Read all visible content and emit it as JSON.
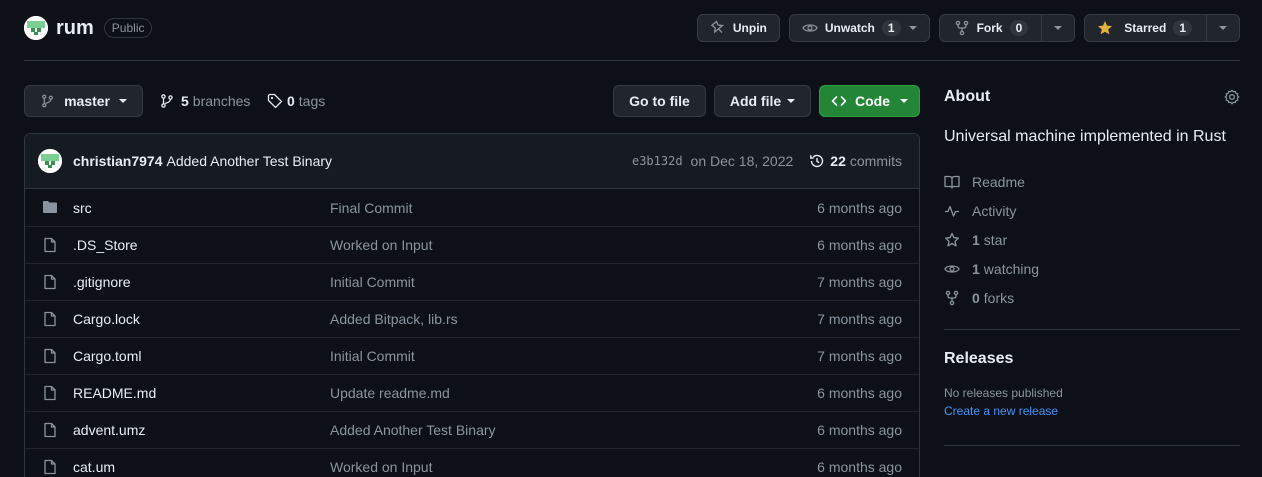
{
  "repo": {
    "name": "rum",
    "visibility": "Public",
    "actions": {
      "unpin": "Unpin",
      "unwatch": "Unwatch",
      "unwatch_count": "1",
      "fork": "Fork",
      "fork_count": "0",
      "starred": "Starred",
      "starred_count": "1"
    }
  },
  "toolbar": {
    "branch": "master",
    "branches_count": "5",
    "branches_label": "branches",
    "tags_count": "0",
    "tags_label": "tags",
    "go_to_file": "Go to file",
    "add_file": "Add file",
    "code": "Code"
  },
  "commit": {
    "author": "christian7974",
    "message": "Added Another Test Binary",
    "sha": "e3b132d",
    "date": "on Dec 18, 2022",
    "commits_count": "22",
    "commits_label": "commits"
  },
  "files": [
    {
      "name": "src",
      "message": "Final Commit",
      "age": "6 months ago",
      "type": "folder"
    },
    {
      "name": ".DS_Store",
      "message": "Worked on Input",
      "age": "6 months ago",
      "type": "file"
    },
    {
      "name": ".gitignore",
      "message": "Initial Commit",
      "age": "7 months ago",
      "type": "file"
    },
    {
      "name": "Cargo.lock",
      "message": "Added Bitpack, lib.rs",
      "age": "7 months ago",
      "type": "file"
    },
    {
      "name": "Cargo.toml",
      "message": "Initial Commit",
      "age": "7 months ago",
      "type": "file"
    },
    {
      "name": "README.md",
      "message": "Update readme.md",
      "age": "6 months ago",
      "type": "file"
    },
    {
      "name": "advent.umz",
      "message": "Added Another Test Binary",
      "age": "6 months ago",
      "type": "file"
    },
    {
      "name": "cat.um",
      "message": "Worked on Input",
      "age": "6 months ago",
      "type": "file"
    }
  ],
  "about": {
    "title": "About",
    "description": "Universal machine implemented in Rust",
    "readme": "Readme",
    "activity": "Activity",
    "stars_count": "1",
    "stars_label": "star",
    "watching_count": "1",
    "watching_label": "watching",
    "forks_count": "0",
    "forks_label": "forks"
  },
  "releases": {
    "title": "Releases",
    "none": "No releases published",
    "create": "Create a new release"
  },
  "colors": {
    "background": "#0d1117",
    "code_button": "#238636",
    "link": "#4493f8",
    "star": "#e3b341"
  }
}
